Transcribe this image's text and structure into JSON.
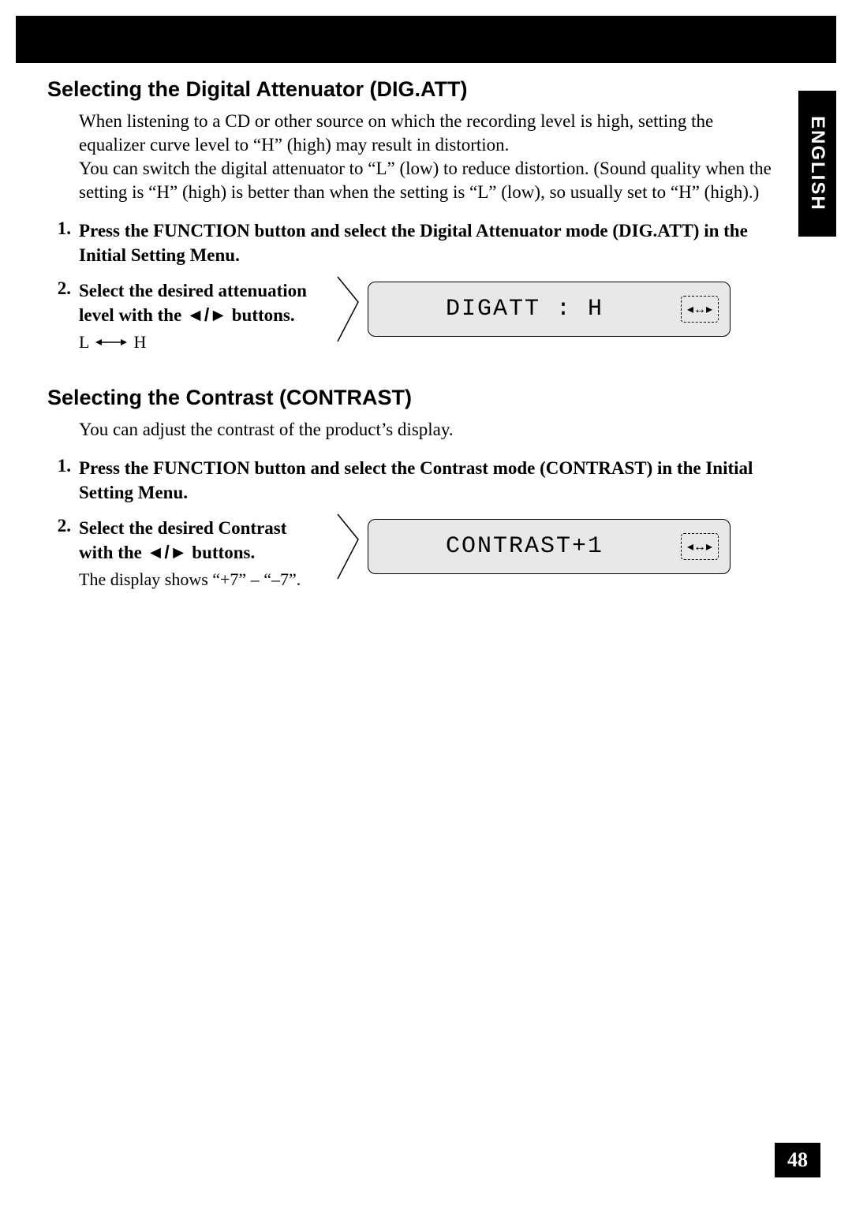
{
  "sideTab": "ENGLISH",
  "pageNumber": "48",
  "section1": {
    "heading": "Selecting the Digital Attenuator (DIG.ATT)",
    "intro": "When listening to a CD or other source on which the recording level is high, setting the equalizer curve level to “H” (high) may result in distortion.\nYou can switch the digital attenuator to “L” (low) to reduce distortion. (Sound quality when the setting is “H” (high) is better than when the setting is “L” (low), so usually set to “H” (high).)",
    "step1_num": "1.",
    "step1": "Press the FUNCTION button and select the Digital Attenuator mode (DIG.ATT) in the Initial Setting Menu.",
    "step2_num": "2.",
    "step2_a": "Select the desired attenuation level with the ",
    "step2_b": " buttons.",
    "step2_buttons": "◄/►",
    "step2_note_L": "L",
    "step2_note_H": "H",
    "lcd": "DIGATT : H",
    "lcd_icon": "◂↔▸"
  },
  "section2": {
    "heading": "Selecting the Contrast (CONTRAST)",
    "intro": "You can adjust the contrast of the product’s display.",
    "step1_num": "1.",
    "step1": "Press the FUNCTION button and select the Contrast mode (CONTRAST) in the Initial Setting Menu.",
    "step2_num": "2.",
    "step2_a": "Select the desired Contrast with the ",
    "step2_b": " buttons.",
    "step2_buttons": "◄/►",
    "step2_note": "The display shows “+7” – “–7”.",
    "lcd": "CONTRAST+1",
    "lcd_icon": "◂↔▸"
  }
}
